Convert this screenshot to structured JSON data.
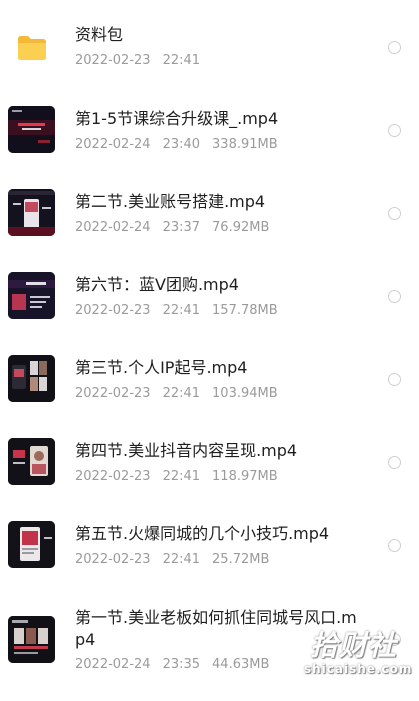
{
  "files": [
    {
      "name": "资料包",
      "date": "2022-02-23",
      "time": "22:41",
      "size": "",
      "icon": "folder-icon"
    },
    {
      "name": "第1-5节课综合升级课_.mp4",
      "date": "2022-02-24",
      "time": "23:40",
      "size": "338.91MB",
      "icon": "video-thumbnail"
    },
    {
      "name": "第二节.美业账号搭建.mp4",
      "date": "2022-02-24",
      "time": "23:37",
      "size": "76.92MB",
      "icon": "video-thumbnail"
    },
    {
      "name": "第六节：蓝V团购.mp4",
      "date": "2022-02-23",
      "time": "22:41",
      "size": "157.78MB",
      "icon": "video-thumbnail"
    },
    {
      "name": "第三节.个人IP起号.mp4",
      "date": "2022-02-23",
      "time": "22:41",
      "size": "103.94MB",
      "icon": "video-thumbnail"
    },
    {
      "name": "第四节.美业抖音内容呈现.mp4",
      "date": "2022-02-23",
      "time": "22:41",
      "size": "118.97MB",
      "icon": "video-thumbnail"
    },
    {
      "name": "第五节.火爆同城的几个小技巧.mp4",
      "date": "2022-02-23",
      "time": "22:41",
      "size": "25.72MB",
      "icon": "video-thumbnail"
    },
    {
      "name": "第一节.美业老板如何抓住同城号风口.mp4",
      "date": "2022-02-24",
      "time": "23:35",
      "size": "44.63MB",
      "icon": "video-thumbnail"
    }
  ],
  "watermark": {
    "chinese": "拾财社",
    "latin": "shicaishe.com"
  },
  "colors": {
    "folder": "#f7c84a",
    "text": "#1f1f1f",
    "meta": "#9a9a9a",
    "radio": "#cfcfcf"
  }
}
